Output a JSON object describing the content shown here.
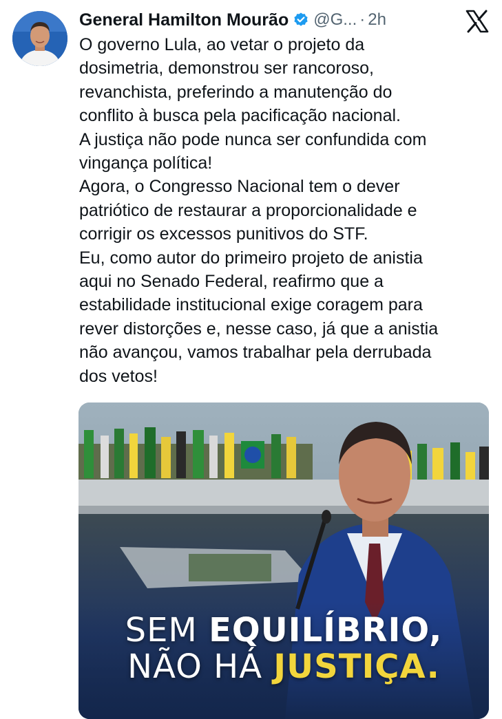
{
  "tweet": {
    "author_name": "General Hamilton Mourão",
    "handle": "@G...",
    "separator": "·",
    "time": "2h",
    "paragraphs": [
      "O governo Lula, ao vetar o projeto da",
      "dosimetria, demonstrou ser rancoroso,",
      "revanchista, preferindo a manutenção do",
      "conflito à busca pela pacificação nacional.",
      "A justiça não pode nunca ser confundida com",
      "vingança política!",
      "Agora, o Congresso Nacional tem o dever",
      "patriótico de restaurar a proporcionalidade e",
      "corrigir os excessos punitivos do STF.",
      "Eu, como autor do primeiro projeto de anistia",
      "aqui no Senado Federal, reafirmo que a",
      "estabilidade institucional exige coragem para",
      "rever distorções e, nesse caso, já que a anistia",
      "não avançou, vamos trabalhar pela derrubada",
      "dos vetos!"
    ]
  },
  "media": {
    "headline_line1_thin": "SEM ",
    "headline_line1_bold": "EQUILÍBRIO,",
    "headline_line2_thin": "NÃO HÁ ",
    "headline_line2_bold": "JUSTIÇA."
  },
  "icons": {
    "verified": "verified-badge-icon",
    "brand": "x-logo-icon"
  },
  "colors": {
    "verified_blue": "#1d9bf0",
    "secondary_text": "#536471",
    "headline_yellow": "#f2d53c"
  }
}
